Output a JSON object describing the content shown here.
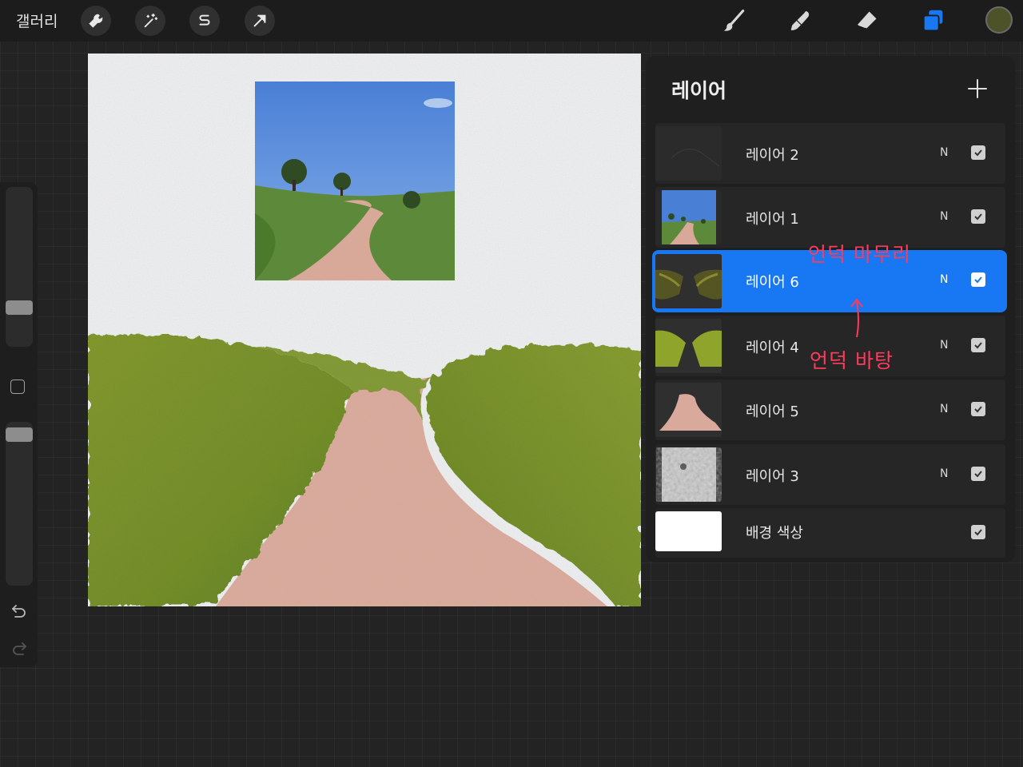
{
  "topbar": {
    "gallery_label": "갤러리",
    "tools_left": [
      "wrench-icon",
      "magic-wand-icon",
      "selection-icon",
      "transform-arrow-icon"
    ],
    "tools_right": [
      "brush-icon",
      "smudge-icon",
      "eraser-icon",
      "layers-icon"
    ],
    "active_color": "#4d5228",
    "accent": "#1877f2"
  },
  "layers_panel": {
    "title": "레이어",
    "layers": [
      {
        "name": "레이어 2",
        "blend": "N",
        "visible": true,
        "selected": false
      },
      {
        "name": "레이어 1",
        "blend": "N",
        "visible": true,
        "selected": false
      },
      {
        "name": "레이어 6",
        "blend": "N",
        "visible": true,
        "selected": true
      },
      {
        "name": "레이어 4",
        "blend": "N",
        "visible": true,
        "selected": false
      },
      {
        "name": "레이어 5",
        "blend": "N",
        "visible": true,
        "selected": false
      },
      {
        "name": "레이어 3",
        "blend": "N",
        "visible": true,
        "selected": false
      }
    ],
    "background": {
      "name": "배경 색상",
      "visible": true,
      "color": "#ffffff"
    }
  },
  "annotations": {
    "top": "언덕 마무리",
    "bottom": "언덕 바탕"
  }
}
